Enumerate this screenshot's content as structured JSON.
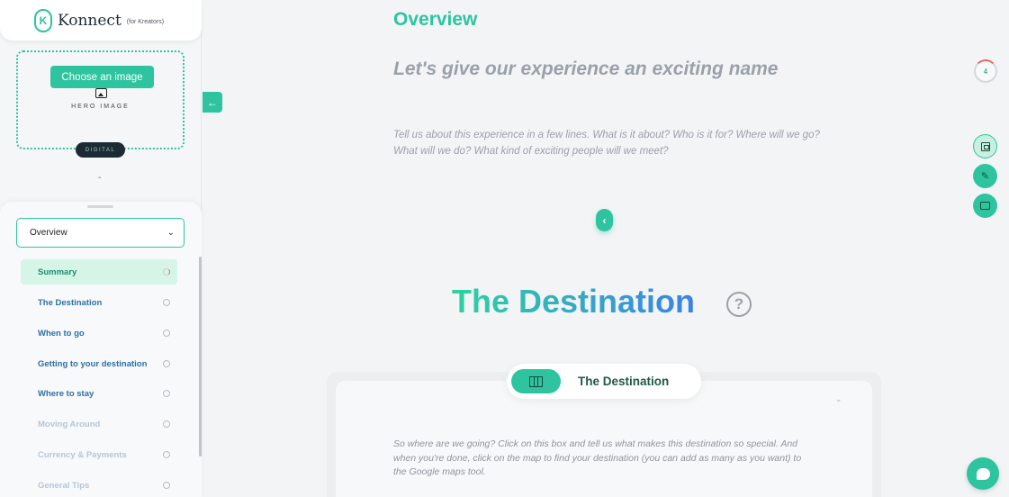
{
  "brand": {
    "name": "Konnect",
    "subtitle": "(for Kreators)"
  },
  "hero": {
    "choose_label": "Choose an image",
    "image_label": "HERO IMAGE",
    "type_badge": "DIGITAL",
    "placeholder": "-"
  },
  "nav": {
    "selected_section": "Overview",
    "items": [
      {
        "label": "Summary",
        "state": "active"
      },
      {
        "label": "The Destination",
        "state": "normal"
      },
      {
        "label": "When to go",
        "state": "normal"
      },
      {
        "label": "Getting to your destination",
        "state": "normal"
      },
      {
        "label": "Where to stay",
        "state": "normal"
      },
      {
        "label": "Moving Around",
        "state": "faded"
      },
      {
        "label": "Currency & Payments",
        "state": "faded"
      },
      {
        "label": "General Tips",
        "state": "faded"
      }
    ]
  },
  "main": {
    "overview_heading": "Overview",
    "name_placeholder": "Let's give our experience an exciting name",
    "description_placeholder": "Tell us about this experience in a few lines. What is it about? Who is it for? Where will we go? What will we do? What kind of exciting people will we meet?",
    "destination_heading": "The Destination",
    "help_symbol": "?",
    "destination_tab_label": "The Destination",
    "destination_text": "So where are we going? Click on this box and tell us what makes this destination so special. And when you're done, click on the map to find your destination (you can add as many as you want) to the Google maps tool."
  },
  "rail": {
    "progress_count": "4"
  },
  "icons": {
    "collapse": "arrow-left-icon",
    "expand": "chevron-left-icon",
    "map": "map-icon",
    "save": "save-icon",
    "edit": "pencil-icon",
    "comment": "comment-icon",
    "chat": "chat-icon"
  },
  "colors": {
    "accent": "#2ec4a0",
    "nav_blue": "#2c6fa8",
    "faded_blue": "#b7c6d9",
    "gradient_start": "#2ed3a0",
    "gradient_end": "#3b82e8"
  }
}
